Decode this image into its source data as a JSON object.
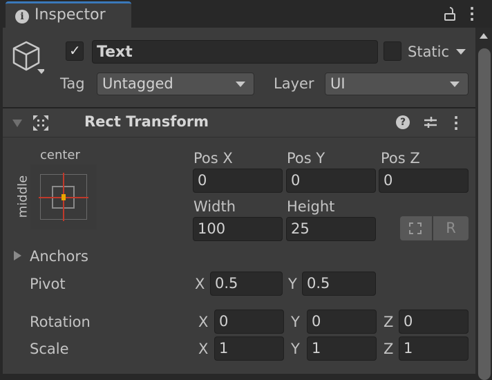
{
  "tab": {
    "title": "Inspector"
  },
  "object": {
    "active": true,
    "name": "Text",
    "static_label": "Static",
    "static": false,
    "tag_label": "Tag",
    "tag": "Untagged",
    "layer_label": "Layer",
    "layer": "UI"
  },
  "component": {
    "title": "Rect Transform",
    "expanded": true
  },
  "anchor_preset": {
    "horizontal": "center",
    "vertical": "middle"
  },
  "position": {
    "labels": [
      "Pos X",
      "Pos Y",
      "Pos Z"
    ],
    "values": [
      "0",
      "0",
      "0"
    ]
  },
  "size": {
    "width_label": "Width",
    "height_label": "Height",
    "width": "100",
    "height": "25",
    "raw_edit_label": "R"
  },
  "anchors": {
    "label": "Anchors"
  },
  "pivot": {
    "label": "Pivot",
    "x_label": "X",
    "y_label": "Y",
    "x": "0.5",
    "y": "0.5"
  },
  "rotation": {
    "label": "Rotation",
    "x_label": "X",
    "y_label": "Y",
    "z_label": "Z",
    "x": "0",
    "y": "0",
    "z": "0"
  },
  "scale": {
    "label": "Scale",
    "x_label": "X",
    "y_label": "Y",
    "z_label": "Z",
    "x": "1",
    "y": "1",
    "z": "1"
  },
  "colors": {
    "accent": "#3a79bb",
    "panel": "#3c3c3c",
    "field": "#2a2a2a",
    "anchor_pivot": "#e8a500",
    "anchor_lines": "#c0392b"
  }
}
